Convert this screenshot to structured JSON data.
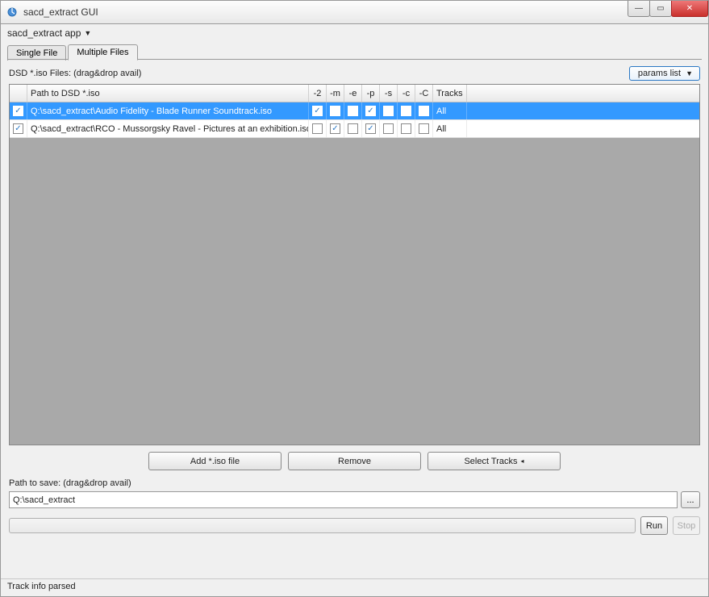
{
  "window": {
    "title": "sacd_extract GUI",
    "min_symbol": "—",
    "max_symbol": "▭",
    "close_symbol": "✕"
  },
  "menu": {
    "app_label": "sacd_extract app",
    "dropdown_glyph": "▼"
  },
  "tabs": {
    "single": "Single File",
    "multiple": "Multiple Files"
  },
  "panel": {
    "dsd_label": "DSD *.iso Files: (drag&drop avail)",
    "params_btn": "params list",
    "params_glyph": "▼"
  },
  "grid": {
    "headers": {
      "path": "Path to DSD *.iso",
      "f2": "-2",
      "fm": "-m",
      "fe": "-e",
      "fp": "-p",
      "fs": "-s",
      "fc": "-c",
      "fC": "-C",
      "tracks": "Tracks"
    },
    "rows": [
      {
        "selected": true,
        "row_check": true,
        "path": "Q:\\sacd_extract\\Audio Fidelity - Blade Runner Soundtrack.iso",
        "f2": true,
        "fm": false,
        "fe": false,
        "fp": true,
        "fs": false,
        "fc": false,
        "fC": false,
        "tracks": "All"
      },
      {
        "selected": false,
        "row_check": true,
        "path": "Q:\\sacd_extract\\RCO - Mussorgsky Ravel - Pictures at an exhibition.iso",
        "f2": false,
        "fm": true,
        "fe": false,
        "fp": true,
        "fs": false,
        "fc": false,
        "fC": false,
        "tracks": "All"
      }
    ]
  },
  "buttons": {
    "add": "Add *.iso file",
    "remove": "Remove",
    "select_tracks": "Select Tracks",
    "select_tracks_glyph": "◂",
    "run": "Run",
    "stop": "Stop",
    "browse": "..."
  },
  "save": {
    "label": "Path to save: (drag&drop avail)",
    "value": "Q:\\sacd_extract"
  },
  "status": {
    "text": "Track info parsed"
  }
}
